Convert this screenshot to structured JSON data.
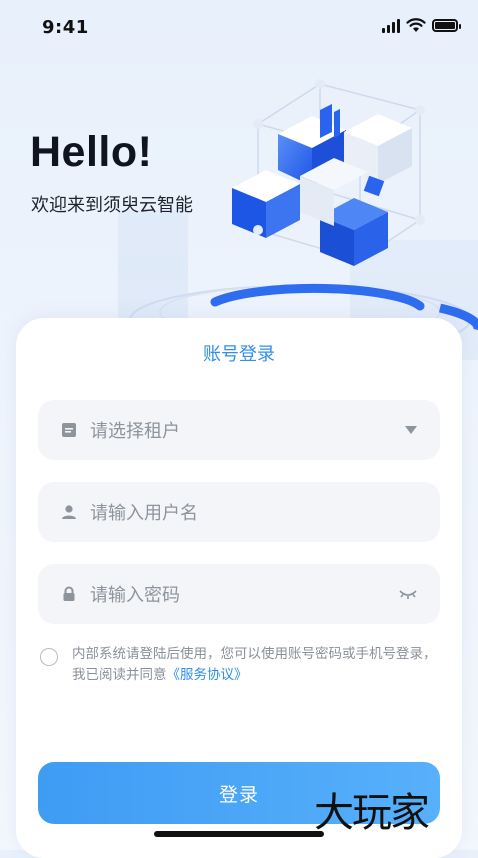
{
  "status_bar": {
    "time": "9:41",
    "icons": [
      "signal-icon",
      "wifi-icon",
      "battery-icon"
    ]
  },
  "hero": {
    "title": "Hello!",
    "subtitle": "欢迎来到须臾云智能",
    "illustration": "isometric-cube-illustration"
  },
  "login_card": {
    "title": "账号登录",
    "tenant_field": {
      "placeholder": "请选择租户",
      "icon": "document-icon",
      "right_icon": "caret-down-icon"
    },
    "username_field": {
      "placeholder": "请输入用户名",
      "icon": "user-icon"
    },
    "password_field": {
      "placeholder": "请输入密码",
      "icon": "lock-icon",
      "right_icon": "eye-closed-icon"
    },
    "agreement": {
      "checked": false,
      "text": "内部系统请登陆后使用，您可以使用账号密码或手机号登录，我已阅读并同意",
      "link": "《服务协议》"
    },
    "login_button": "登录"
  },
  "watermark": "大玩家",
  "colors": {
    "accent": "#2f8fe8",
    "button_start": "#3e9cf3",
    "button_end": "#58b0fb",
    "field_bg": "#f3f5f8",
    "placeholder": "#8e949c",
    "title": "#0f1420"
  }
}
